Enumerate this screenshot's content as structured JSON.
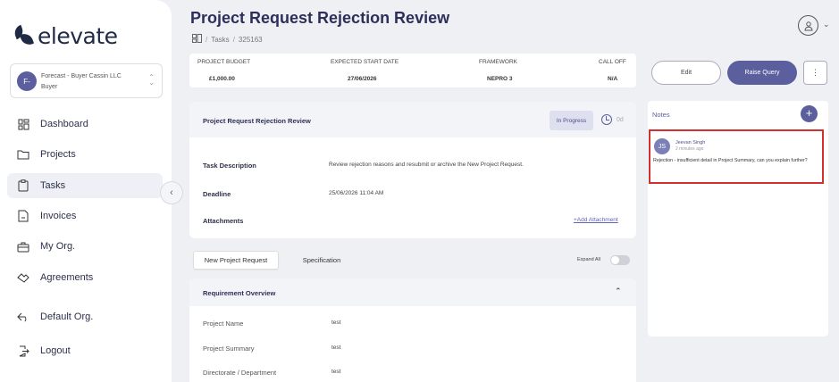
{
  "sidebar": {
    "logo": "elevate",
    "org": {
      "initials": "F-",
      "name": "Forecast - Buyer Cassin LLC",
      "role": "Buyer"
    },
    "items": [
      {
        "label": "Dashboard",
        "icon": "dashboard-icon"
      },
      {
        "label": "Projects",
        "icon": "folder-icon"
      },
      {
        "label": "Tasks",
        "icon": "clipboard-icon"
      },
      {
        "label": "Invoices",
        "icon": "invoice-icon"
      },
      {
        "label": "My Org.",
        "icon": "briefcase-icon"
      },
      {
        "label": "Agreements",
        "icon": "handshake-icon"
      },
      {
        "label": "Default Org.",
        "icon": "back-arrow-icon"
      },
      {
        "label": "Logout",
        "icon": "logout-icon"
      }
    ],
    "active_item": "Tasks"
  },
  "header": {
    "title": "Project Request Rejection Review",
    "breadcrumb": [
      "Tasks",
      "325163"
    ]
  },
  "summary": {
    "budget_label": "PROJECT BUDGET",
    "budget_value": "£1,000.00",
    "start_label": "EXPECTED START DATE",
    "start_value": "27/06/2026",
    "framework_label": "FRAMEWORK",
    "framework_value": "NEPRO 3",
    "calloff_label": "CALL OFF",
    "calloff_value": "N/A"
  },
  "actions": {
    "edit": "Edit",
    "raise_query": "Raise Query",
    "more": "⋮"
  },
  "task": {
    "title": "Project Request Rejection Review",
    "status": "In Progress",
    "days": "0d",
    "description_label": "Task Description",
    "description_value": "Review rejection reasons and resubmit or archive the New Project Request.",
    "deadline_label": "Deadline",
    "deadline_value": "25/06/2026 11:04 AM",
    "attachments_label": "Attachments",
    "add_attachment": "+Add Attachment"
  },
  "tabs": {
    "items": [
      "New Project Request",
      "Specification"
    ],
    "active": "New Project Request",
    "expand_all": "Expand All"
  },
  "requirement": {
    "title": "Requirement Overview",
    "rows": [
      {
        "label": "Project Name",
        "value": "test"
      },
      {
        "label": "Project Summary",
        "value": "test"
      },
      {
        "label": "Directorate / Department",
        "value": "test"
      }
    ]
  },
  "notes": {
    "title": "Notes",
    "items": [
      {
        "initials": "JS",
        "author": "Jeevan Singh",
        "time": "2 minutes ago",
        "text": "Rejection - insufficient detail in Project Summary, can you explain further?"
      }
    ]
  },
  "colors": {
    "accent": "#5b5f9e",
    "highlight": "#d32f2f",
    "background": "#eef0f4"
  }
}
